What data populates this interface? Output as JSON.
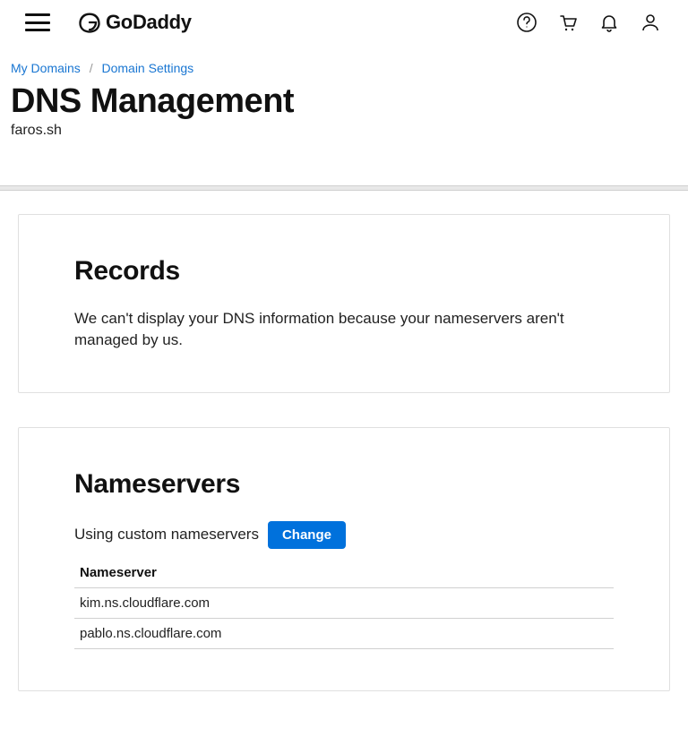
{
  "header": {
    "brand": "GoDaddy"
  },
  "breadcrumb": {
    "items": [
      "My Domains",
      "Domain Settings"
    ]
  },
  "page": {
    "title": "DNS Management",
    "subtitle": "faros.sh"
  },
  "records": {
    "heading": "Records",
    "message": "We can't display your DNS information because your nameservers aren't managed by us."
  },
  "nameservers": {
    "heading": "Nameservers",
    "status": "Using custom nameservers",
    "change_label": "Change",
    "column_header": "Nameserver",
    "items": [
      "kim.ns.cloudflare.com",
      "pablo.ns.cloudflare.com"
    ]
  }
}
